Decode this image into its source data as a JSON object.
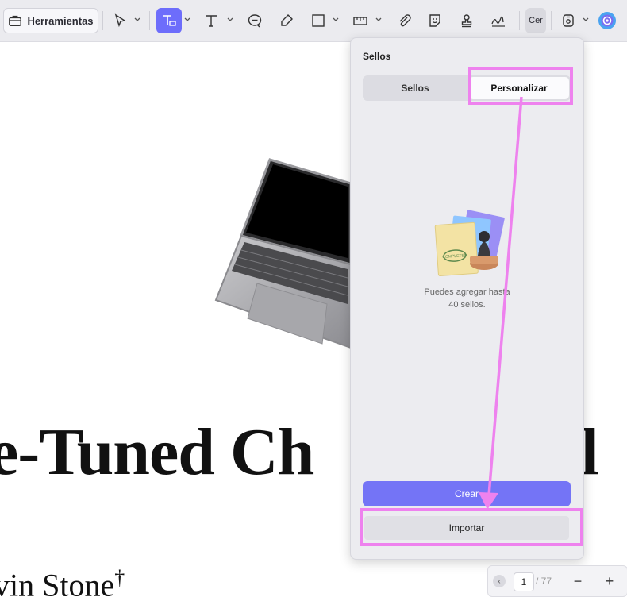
{
  "toolbar": {
    "tools_label": "Herramientas",
    "cert_label": "Cer",
    "icons": [
      "toolbox-icon",
      "select-pointer-icon",
      "text-box-icon",
      "text-icon",
      "comment-icon",
      "highlighter-icon",
      "rectangle-icon",
      "measure-icon",
      "attachment-icon",
      "sticker-icon",
      "stamp-icon",
      "signature-icon",
      "certificate-icon",
      "save-icon",
      "ai-assistant-icon"
    ]
  },
  "document": {
    "heading": "e-Tuned Ch",
    "heading_tail": "el",
    "author": "vin Stone",
    "author_mark": "†"
  },
  "panel": {
    "title": "Sellos",
    "tab_stamps": "Sellos",
    "tab_custom": "Personalizar",
    "empty_message_line1": "Puedes agregar hasta",
    "empty_message_line2": "40 sellos.",
    "illustration_stamp_text": "COMPLETED",
    "create_button": "Crear",
    "import_button": "Importar"
  },
  "pager": {
    "current_page": "1",
    "total": "/ 77",
    "zoom_out": "−",
    "zoom_in": "+"
  },
  "colors": {
    "accent": "#7474f6",
    "annotation": "#ee82ee"
  }
}
